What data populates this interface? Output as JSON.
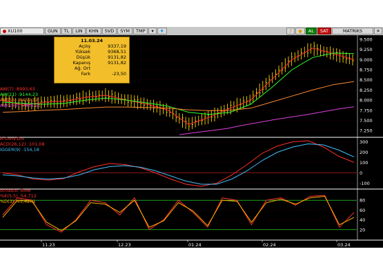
{
  "toolbar": {
    "symbol": "XU100",
    "buttons": [
      "GUN",
      "TL",
      "LIN",
      "KHN",
      "SVD",
      "SYM",
      "TMP"
    ],
    "al_label": "AL",
    "sat_label": "SAT",
    "matriks_label": "MATRIKS"
  },
  "info_box": {
    "date": "11.03.24",
    "rows": [
      {
        "label": "Açılış",
        "value": "9337,19"
      },
      {
        "label": "Yüksek",
        "value": "9368,51"
      },
      {
        "label": "Düşük",
        "value": "9131,82"
      },
      {
        "label": "Kapanış",
        "value": "9131,82"
      },
      {
        "label": "Ağ. Ort",
        "value": ""
      },
      {
        "label": "Fark",
        "value": "-23,50"
      }
    ]
  },
  "price_legend": [
    {
      "label": "AW(7)",
      "value": ":8993,63",
      "color": "#ff3030"
    },
    {
      "label": "AW(21)",
      "value": ":9144,23",
      "color": "#30ff30"
    },
    {
      "label": "AW(56)",
      "value": ":8459,32",
      "color": "#ff8a30"
    },
    {
      "label": "AW(200)",
      "value": ":7836,51",
      "color": "#e040e0"
    }
  ],
  "macd_legend": {
    "title": "A Conv.Div",
    "items": [
      {
        "label": "ACD(26,12)",
        "value": ":101,08",
        "color": "#ff3030"
      },
      {
        "label": "IGGER(9)",
        "value": ":154,18",
        "color": "#40c0ff"
      }
    ]
  },
  "stoch_legend": {
    "title": "ochastic Slow",
    "items": [
      {
        "label": "%K(5,5)",
        "value": ":54,712",
        "color": "#ff3030"
      },
      {
        "label": "%D(3)",
        "value": ":45,4201",
        "color": "#ffb000"
      }
    ]
  },
  "x_axis_labels": [
    "11.23",
    "12.23",
    "01.24",
    "02.24",
    "03.24"
  ],
  "colors": {
    "background": "#000000",
    "candle": "#ffd700",
    "grid": "#5a0000",
    "ma7": "#ff3030",
    "ma21": "#30ff30",
    "ma56": "#ff8a30",
    "ma200": "#e040e0",
    "macd": "#ff3030",
    "signal": "#40c0ff",
    "stoch_k": "#ff3030",
    "stoch_d": "#ffb000"
  },
  "chart_data": [
    {
      "type": "line",
      "title": "XU100",
      "x": [
        "11.23",
        "12.23",
        "01.24",
        "02.24",
        "03.24"
      ],
      "ylim": [
        7100,
        9600
      ],
      "y_ticks": [
        7250,
        7500,
        7750,
        8000,
        8250,
        8500,
        8750,
        9000,
        9250,
        9500
      ],
      "series": [
        {
          "name": "AW(7)",
          "values": [
            8000,
            7870,
            7950,
            7970,
            8070,
            8120,
            8000,
            7900,
            7750,
            7400,
            7580,
            7800,
            8000,
            8500,
            9000,
            9280,
            9150,
            8990
          ]
        },
        {
          "name": "AW(21)",
          "values": [
            7950,
            7920,
            7900,
            7920,
            8000,
            8050,
            8000,
            7930,
            7850,
            7700,
            7650,
            7700,
            7900,
            8300,
            8750,
            9050,
            9160,
            9144
          ]
        },
        {
          "name": "AW(56)",
          "values": [
            7700,
            7720,
            7750,
            7770,
            7800,
            7830,
            7830,
            7820,
            7800,
            7760,
            7740,
            7750,
            7800,
            7950,
            8100,
            8250,
            8380,
            8459
          ]
        },
        {
          "name": "AW(200)",
          "values": [
            7150,
            7200,
            7250,
            7300,
            7380,
            7450,
            7520,
            7580,
            7640,
            7710,
            7780,
            7836
          ]
        }
      ]
    },
    {
      "type": "line",
      "title": "A Conv.Div",
      "ylim": [
        -150,
        330
      ],
      "y_ticks": [
        -100,
        0,
        100,
        200,
        300
      ],
      "series": [
        {
          "name": "ACD(26,12)",
          "values": [
            0,
            -20,
            -60,
            -70,
            -55,
            10,
            60,
            90,
            80,
            50,
            0,
            -60,
            -110,
            -130,
            -100,
            -20,
            80,
            190,
            260,
            300,
            310,
            250,
            160,
            101
          ]
        },
        {
          "name": "IGGER(9)",
          "values": [
            -20,
            -30,
            -50,
            -60,
            -50,
            -20,
            30,
            60,
            70,
            55,
            20,
            -30,
            -80,
            -110,
            -110,
            -60,
            20,
            120,
            200,
            250,
            280,
            270,
            220,
            154
          ]
        }
      ]
    },
    {
      "type": "line",
      "title": "ochastic Slow",
      "ylim": [
        0,
        100
      ],
      "y_ticks": [
        20,
        40,
        60,
        80
      ],
      "series": [
        {
          "name": "%K(5,5)",
          "values": [
            50,
            85,
            80,
            30,
            15,
            40,
            80,
            75,
            50,
            85,
            20,
            40,
            80,
            55,
            25,
            85,
            80,
            30,
            80,
            85,
            70,
            88,
            90,
            25,
            55
          ]
        },
        {
          "name": "%D(3)",
          "values": [
            45,
            80,
            78,
            35,
            18,
            38,
            75,
            72,
            55,
            80,
            25,
            38,
            75,
            58,
            28,
            80,
            78,
            35,
            75,
            82,
            72,
            85,
            88,
            30,
            45
          ]
        }
      ]
    }
  ]
}
